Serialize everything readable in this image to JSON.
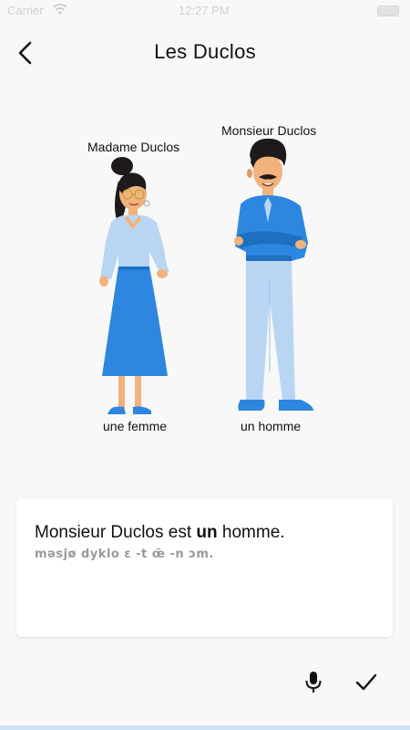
{
  "status_bar": {
    "carrier": "Carrier",
    "time": "12:27 PM"
  },
  "header": {
    "title": "Les Duclos",
    "back_icon": "chevron-left-icon"
  },
  "illustration": {
    "woman": {
      "name_label": "Madame Duclos",
      "word_label": "une femme"
    },
    "man": {
      "name_label": "Monsieur Duclos",
      "word_label": "un homme"
    },
    "colors": {
      "blue": "#2d86e0",
      "light_blue": "#b8d6f4",
      "skin": "#f2b27c",
      "hair": "#1e1a1a"
    }
  },
  "card": {
    "sentence_before": "Monsieur Duclos est ",
    "sentence_bold": "un",
    "sentence_after": " homme.",
    "phonetic": "məsjø dyklo ɛ -t œ̃ -n ɔm."
  },
  "actions": {
    "mic_icon": "microphone-icon",
    "check_icon": "checkmark-icon"
  }
}
